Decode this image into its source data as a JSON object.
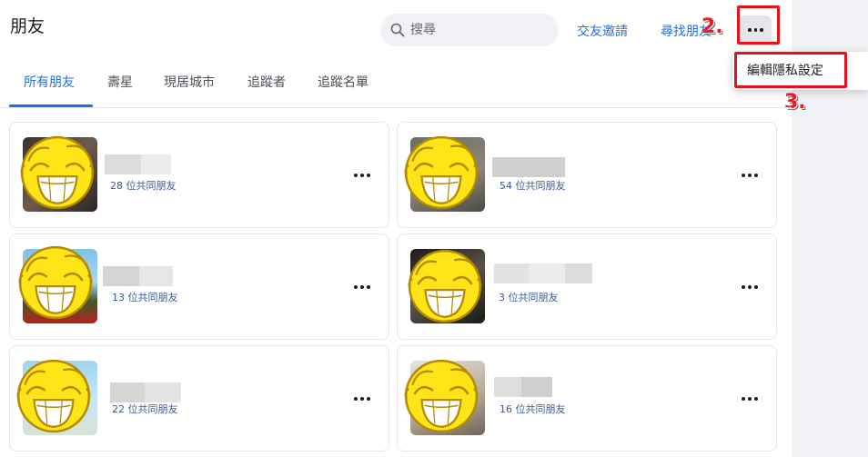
{
  "page": {
    "title": "朋友"
  },
  "search": {
    "placeholder": "搜尋"
  },
  "header": {
    "friend_requests": "交友邀請",
    "find_friends": "尋找朋友"
  },
  "menu": {
    "edit_privacy": "編輯隱私設定"
  },
  "annotations": {
    "step2": "2.",
    "step3": "3."
  },
  "tabs": [
    {
      "label": "所有朋友",
      "active": true
    },
    {
      "label": "壽星"
    },
    {
      "label": "現居城市"
    },
    {
      "label": "追蹤者"
    },
    {
      "label": "追蹤名單"
    }
  ],
  "friends": [
    {
      "mutual": "28 位共同朋友"
    },
    {
      "mutual": "54 位共同朋友"
    },
    {
      "mutual": "13 位共同朋友"
    },
    {
      "mutual": "3 位共同朋友"
    },
    {
      "mutual": "22 位共同朋友"
    },
    {
      "mutual": "16 位共同朋友"
    }
  ],
  "colors": {
    "accent": "#216fdb",
    "annotation_red": "#e8101a",
    "smiley": "#ffe417",
    "smiley_outline": "#b38a05"
  },
  "icons": [
    "search-icon",
    "more-icon",
    "smiley-icon"
  ]
}
